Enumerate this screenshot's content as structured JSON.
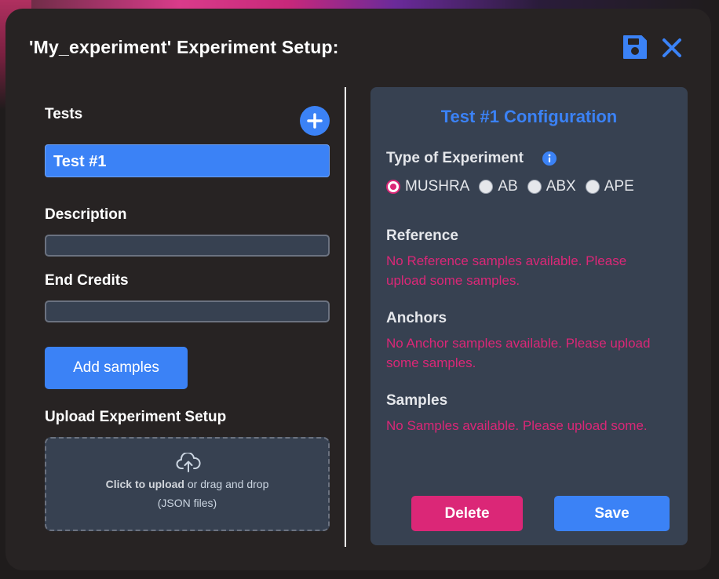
{
  "modal": {
    "title": "'My_experiment' Experiment Setup:",
    "save_icon": "floppy-disk-icon",
    "close_icon": "close-x-icon"
  },
  "left": {
    "tests_label": "Tests",
    "add_test_icon": "plus-icon",
    "tests": [
      {
        "label": "Test #1",
        "selected": true
      }
    ],
    "description_label": "Description",
    "description_value": "",
    "end_credits_label": "End Credits",
    "end_credits_value": "",
    "add_samples_label": "Add samples",
    "upload_label": "Upload Experiment Setup",
    "upload": {
      "icon": "cloud-upload-icon",
      "click_text": "Click to upload",
      "rest_text": " or drag and drop",
      "hint": "(JSON files)"
    }
  },
  "config": {
    "title": "Test #1 Configuration",
    "type_label": "Type of Experiment",
    "info_icon": "info-icon",
    "types": [
      {
        "label": "MUSHRA",
        "checked": true
      },
      {
        "label": "AB",
        "checked": false
      },
      {
        "label": "ABX",
        "checked": false
      },
      {
        "label": "APE",
        "checked": false
      }
    ],
    "reference_label": "Reference",
    "reference_warning": "No Reference samples available. Please upload some samples.",
    "anchors_label": "Anchors",
    "anchors_warning": "No Anchor samples available. Please upload some samples.",
    "samples_label": "Samples",
    "samples_warning": "No Samples available. Please upload some.",
    "delete_label": "Delete",
    "save_label": "Save"
  },
  "colors": {
    "accent_blue": "#3b82f6",
    "accent_pink": "#db2777",
    "panel": "#374151",
    "modal_bg": "#272323"
  }
}
